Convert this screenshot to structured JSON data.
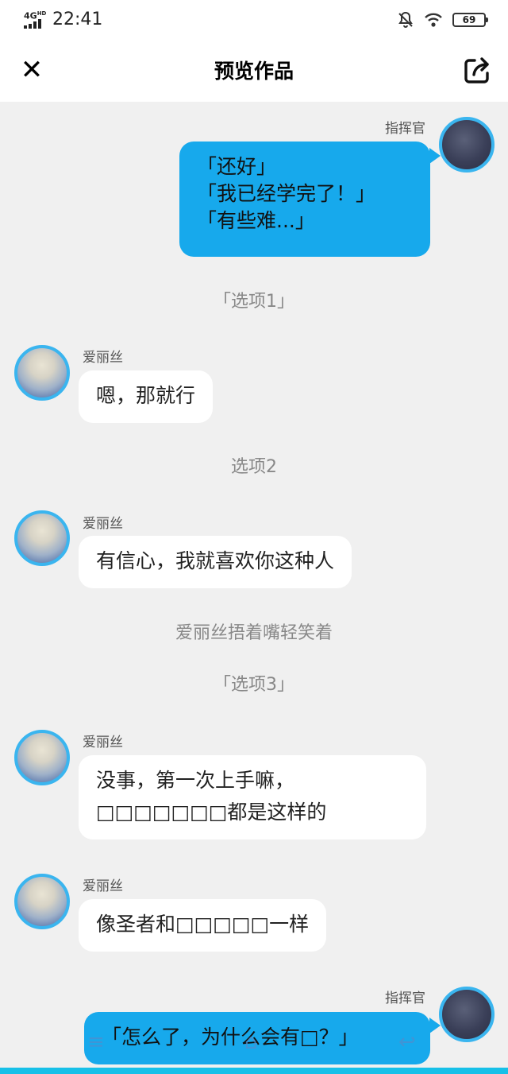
{
  "status_bar": {
    "network": "4G",
    "network_sup": "HD",
    "time": "22:41",
    "battery": "69"
  },
  "header": {
    "title": "预览作品"
  },
  "messages": [
    {
      "speaker": "指挥官",
      "lines": [
        "「还好」",
        "「我已经学完了！」",
        "「有些难...」"
      ]
    },
    {
      "narration": "「选项1」"
    },
    {
      "speaker": "爱丽丝",
      "lines": [
        "嗯，那就行"
      ]
    },
    {
      "narration": "选项2"
    },
    {
      "speaker": "爱丽丝",
      "lines": [
        "有信心，我就喜欢你这种人"
      ]
    },
    {
      "narration": "爱丽丝捂着嘴轻笑着"
    },
    {
      "narration": "「选项3」"
    },
    {
      "speaker": "爱丽丝",
      "lines": [
        "没事，第一次上手嘛，",
        "□□□□□□□都是这样的"
      ]
    },
    {
      "speaker": "爱丽丝",
      "lines": [
        "像圣者和□□□□□一样"
      ]
    },
    {
      "speaker": "指挥官",
      "lines": [
        "「怎么了，为什么会有□？」"
      ]
    }
  ],
  "colors": {
    "accent": "#17a9ec",
    "background": "#f0f0f0",
    "avatar_ring": "#3ab5ef"
  }
}
